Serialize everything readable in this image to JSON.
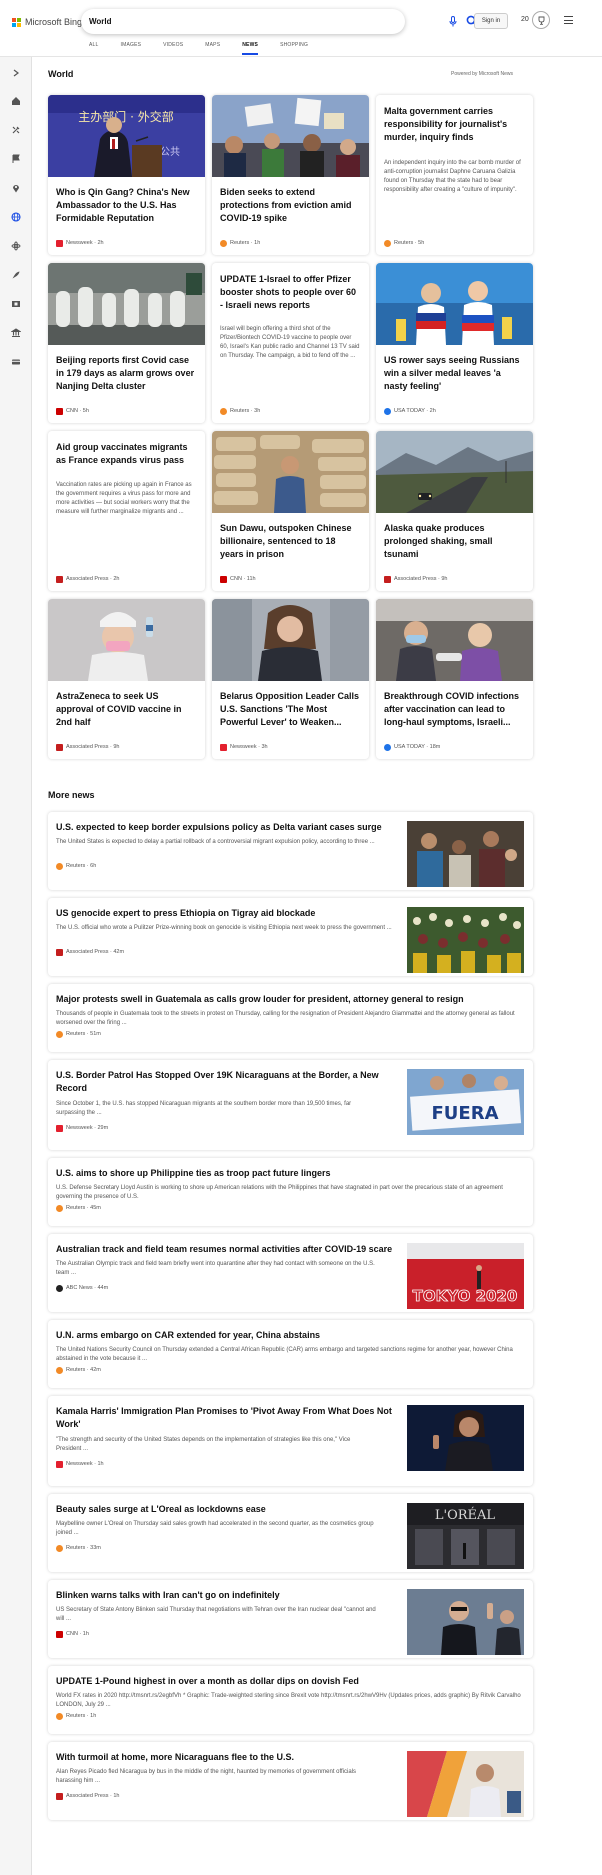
{
  "header": {
    "logo_text": "Microsoft Bing",
    "search_value": "World",
    "signin_label": "Sign in",
    "rewards_points": "20",
    "tabs": [
      {
        "label": "ALL",
        "active": false
      },
      {
        "label": "IMAGES",
        "active": false
      },
      {
        "label": "VIDEOS",
        "active": false
      },
      {
        "label": "MAPS",
        "active": false
      },
      {
        "label": "NEWS",
        "active": true
      },
      {
        "label": "SHOPPING",
        "active": false
      }
    ]
  },
  "rail": {
    "items": [
      "expand-icon",
      "home-icon",
      "tools-icon",
      "flag-icon",
      "location-icon",
      "globe-icon",
      "atom-icon",
      "rocket-icon",
      "film-icon",
      "bank-icon",
      "card-icon"
    ],
    "accent": "#174ae4"
  },
  "world": {
    "title": "World",
    "powered_by": "Powered by Microsoft News",
    "cards": [
      {
        "title": "Who is Qin Gang? China's New Ambassador to the U.S. Has Formidable Reputation",
        "desc": "",
        "source": "Newsweek · 2h",
        "source_color": "#e3202e",
        "image": "podium-photo"
      },
      {
        "title": "Biden seeks to extend protections from eviction amid COVID-19 spike",
        "desc": "",
        "source": "Reuters · 1h",
        "source_color": "#f28a26",
        "image": "protest-photo"
      },
      {
        "title": "Malta government carries responsibility for journalist's murder, inquiry finds",
        "desc": "An independent inquiry into the car bomb murder of anti-corruption journalist Daphne Caruana Galizia found on Thursday that the state had to bear responsibility after creating a \"culture of impunity\".",
        "source": "Reuters · 5h",
        "source_color": "#f28a26",
        "image": ""
      },
      {
        "title": "Beijing reports first Covid case in 179 days as alarm grows over Nanjing Delta cluster",
        "desc": "",
        "source": "CNN · 5h",
        "source_color": "#cc0000",
        "image": "hazmat-photo"
      },
      {
        "title": "UPDATE 1-Israel to offer Pfizer booster shots to people over 60 - Israeli news reports",
        "desc": "Israel will begin offering a third shot of the Pfizer/Biontech COVID-19 vaccine to people over 60, Israel's Kan public radio and Channel 13 TV said on Thursday. The campaign, a bid to fend off the ...",
        "source": "Reuters · 3h",
        "source_color": "#f28a26",
        "image": ""
      },
      {
        "title": "US rower says seeing Russians win a silver medal leaves 'a nasty feeling'",
        "desc": "",
        "source": "USA TODAY · 2h",
        "source_color": "#1e73e8",
        "image": "rowers-photo"
      },
      {
        "title": "Aid group vaccinates migrants as France expands virus pass",
        "desc": "Vaccination rates are picking up again in France as the government requires a virus pass for more and more activities — but social workers worry that the measure will further marginalize migrants and ...",
        "source": "Associated Press · 2h",
        "source_color": "#c41e1e",
        "image": ""
      },
      {
        "title": "Sun Dawu, outspoken Chinese billionaire, sentenced to 18 years in prison",
        "desc": "",
        "source": "CNN · 11h",
        "source_color": "#cc0000",
        "image": "warehouse-photo"
      },
      {
        "title": "Alaska quake produces prolonged shaking, small tsunami",
        "desc": "",
        "source": "Associated Press · 9h",
        "source_color": "#c41e1e",
        "image": "highway-photo"
      },
      {
        "title": "AstraZeneca to seek US approval of COVID vaccine in 2nd half",
        "desc": "",
        "source": "Associated Press · 9h",
        "source_color": "#c41e1e",
        "image": "lab-photo"
      },
      {
        "title": "Belarus Opposition Leader Calls U.S. Sanctions 'The Most Powerful Lever' to Weaken...",
        "desc": "",
        "source": "Newsweek · 3h",
        "source_color": "#e3202e",
        "image": "portrait-photo"
      },
      {
        "title": "Breakthrough COVID infections after vaccination can lead to long-haul symptoms, Israeli...",
        "desc": "",
        "source": "USA TODAY · 18m",
        "source_color": "#1e73e8",
        "image": "vaccination-photo"
      }
    ]
  },
  "more": {
    "title": "More news",
    "items": [
      {
        "title": "U.S. expected to keep border expulsions policy as Delta variant cases surge",
        "desc": "The United States is expected to delay a partial rollback of a controversial migrant expulsion policy, according to three ...",
        "source": "Reuters · 6h",
        "source_color": "#f28a26",
        "thumb": "migrants-photo"
      },
      {
        "title": "US genocide expert to press Ethiopia on Tigray aid blockade",
        "desc": "The U.S. official who wrote a Pulitzer Prize-winning book on genocide is visiting Ethiopia next week to press the government ...",
        "source": "Associated Press · 42m",
        "source_color": "#c41e1e",
        "thumb": "crowd-photo"
      },
      {
        "title": "Major protests swell in Guatemala as calls grow louder for president, attorney general to resign",
        "desc": "Thousands of people in Guatemala took to the streets in protest on Thursday, calling for the resignation of President Alejandro Giammattei and the attorney general as fallout worsened over the firing ...",
        "source": "Reuters · 51m",
        "source_color": "#f28a26",
        "thumb": ""
      },
      {
        "title": "U.S. Border Patrol Has Stopped Over 19K Nicaraguans at the Border, a New Record",
        "desc": "Since October 1, the U.S. has stopped Nicaraguan migrants at the southern border more than 19,500 times, far surpassing the ...",
        "source": "Newsweek · 29m",
        "source_color": "#e3202e",
        "thumb": "banner-photo",
        "thumb_text": "FUERA"
      },
      {
        "title": "U.S. aims to shore up Philippine ties as troop pact future lingers",
        "desc": "U.S. Defense Secretary Lloyd Austin is working to shore up American relations with the Philippines that have stagnated in part over the precarious state of an agreement governing the presence of U.S.",
        "source": "Reuters · 45m",
        "source_color": "#f28a26",
        "thumb": ""
      },
      {
        "title": "Australian track and field team resumes normal activities after COVID-19 scare",
        "desc": "The Australian Olympic track and field team briefly went into quarantine after they had contact with someone on the U.S. team ...",
        "source": "ABC News · 44m",
        "source_color": "#222222",
        "thumb": "tokyo-photo",
        "thumb_text": "TOKYO 2020"
      },
      {
        "title": "U.N. arms embargo on CAR extended for year, China abstains",
        "desc": "The United Nations Security Council on Thursday extended a Central African Republic (CAR) arms embargo and targeted sanctions regime for another year, however China abstained in the vote because it ...",
        "source": "Reuters · 42m",
        "source_color": "#f28a26",
        "thumb": ""
      },
      {
        "title": "Kamala Harris' Immigration Plan Promises to 'Pivot Away From What Does Not Work'",
        "desc": "\"The strength and security of the United States depends on the implementation of strategies like this one,\" Vice President ...",
        "source": "Newsweek · 1h",
        "source_color": "#e3202e",
        "thumb": "speaker-photo"
      },
      {
        "title": "Beauty sales surge at L'Oreal as lockdowns ease",
        "desc": "Maybelline owner L'Oreal on Thursday said sales growth had accelerated in the second quarter, as the cosmetics group joined ...",
        "source": "Reuters · 33m",
        "source_color": "#f28a26",
        "thumb": "storefront-photo",
        "thumb_text": "L'ORÉAL"
      },
      {
        "title": "Blinken warns talks with Iran can't go on indefinitely",
        "desc": "US Secretary of State Antony Blinken said Thursday that negotiations with Tehran over the Iran nuclear deal \"cannot and will ...",
        "source": "CNN · 1h",
        "source_color": "#cc0000",
        "thumb": "diplomat-photo"
      },
      {
        "title": "UPDATE 1-Pound highest in over a month as dollar dips on dovish Fed",
        "desc": "World FX rates in 2020 http://tmsnrt.rs/2egbfVh * Graphic: Trade-weighted sterling since Brexit vote http://tmsnrt.rs/2hwV9Hv (Updates prices, adds graphic) By Ritvik Carvalho LONDON, July 29 ...",
        "source": "Reuters · 1h",
        "source_color": "#f28a26",
        "thumb": ""
      },
      {
        "title": "With turmoil at home, more Nicaraguans flee to the U.S.",
        "desc": "Alan Reyes Picado fled Nicaragua by bus in the middle of the night, haunted by memories of government officials harassing him ...",
        "source": "Associated Press · 1h",
        "source_color": "#c41e1e",
        "thumb": "traveler-photo"
      }
    ]
  }
}
